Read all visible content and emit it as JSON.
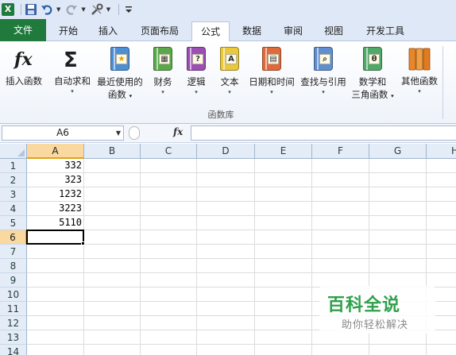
{
  "qat": {
    "app_icon": "excel-app-icon",
    "save_icon": "save-icon",
    "undo_icon": "undo-icon",
    "redo_icon": "redo-icon",
    "tools_icon": "tools-icon",
    "customize_icon": "customize-qat-icon"
  },
  "tabs": {
    "file": "文件",
    "home": "开始",
    "insert": "插入",
    "page_layout": "页面布局",
    "formulas": "公式",
    "data": "数据",
    "review": "审阅",
    "view": "视图",
    "developer": "开发工具"
  },
  "ribbon": {
    "insert_function": {
      "label": "插入函数",
      "icon": "fx-icon"
    },
    "autosum": {
      "label": "自动求和",
      "icon": "sigma-icon"
    },
    "recent": {
      "label1": "最近使用的",
      "label2": "函数",
      "icon": "star-book-icon"
    },
    "financial": {
      "label": "财务",
      "icon": "financial-book-icon"
    },
    "logical": {
      "label": "逻辑",
      "icon": "logical-book-icon"
    },
    "text": {
      "label": "文本",
      "icon": "text-book-icon"
    },
    "datetime": {
      "label": "日期和时间",
      "icon": "calendar-book-icon"
    },
    "lookup": {
      "label": "查找与引用",
      "icon": "lookup-book-icon"
    },
    "math": {
      "label1": "数学和",
      "label2": "三角函数",
      "icon": "theta-book-icon"
    },
    "more": {
      "label": "其他函数",
      "icon": "more-books-icon"
    },
    "group_label": "函数库",
    "dropdown_arrow": "▾"
  },
  "formula_bar": {
    "name_box": "A6",
    "fx": "fx",
    "formula": ""
  },
  "sheet": {
    "columns": [
      "A",
      "B",
      "C",
      "D",
      "E",
      "F",
      "G",
      "H"
    ],
    "rows": [
      "1",
      "2",
      "3",
      "4",
      "5",
      "6",
      "7",
      "8",
      "9",
      "10",
      "11",
      "12",
      "13",
      "14"
    ],
    "values": {
      "A1": "332",
      "A2": "323",
      "A3": "1232",
      "A4": "3223",
      "A5": "5110"
    },
    "active_cell": "A6"
  },
  "watermark": {
    "title": "百科全说",
    "subtitle": "助你轻松解决"
  }
}
